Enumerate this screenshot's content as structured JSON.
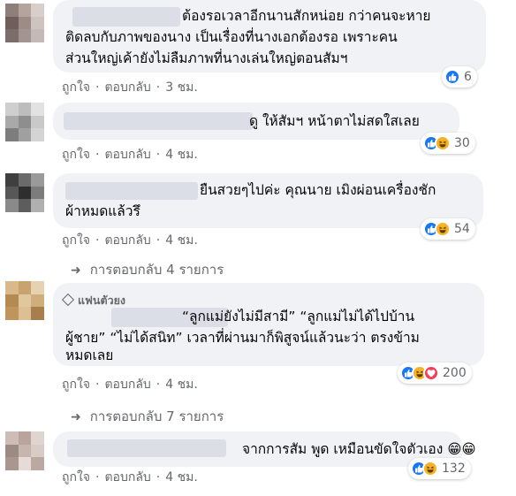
{
  "comments": [
    {
      "text_lines": [
        "ต้องรอเวลาอีกนานสักหน่อย กว่าคนจะหาย",
        "ติดลบกับภาพของนาง เป็นเรื่องที่นางเอกต้องรอ เพราะคน",
        "ส่วนใหญ่เค้ายังไม่ลืมภาพที่นางเล่นใหญ่ตอนสัมฯ"
      ],
      "like": "ถูกใจ",
      "reply": "ตอบกลับ",
      "time": "3 ชม.",
      "reaction_icons": [
        "like-icon"
      ],
      "reaction_count": "6"
    },
    {
      "text_lines": [
        "ดู ให้สัมฯ หน้าตาไม่สดใสเลย"
      ],
      "like": "ถูกใจ",
      "reply": "ตอบกลับ",
      "time": "4 ชม.",
      "reaction_icons": [
        "like-icon",
        "haha-icon"
      ],
      "reaction_count": "30"
    },
    {
      "text_lines": [
        "ยืนสวยๆไปค่ะ คุณนาย เมิงผ่อนเครื่องชัก",
        "ผ้าหมดแล้วรึ"
      ],
      "like": "ถูกใจ",
      "reply": "ตอบกลับ",
      "time": "4 ชม.",
      "reaction_icons": [
        "like-icon",
        "haha-icon"
      ],
      "reaction_count": "54",
      "replies_label": "การตอบกลับ 4 รายการ"
    },
    {
      "badge": "แฟนตัวยง",
      "text_lines": [
        "“ลูกแม่ยังไม่มีสามี” “ลูกแม่ไม่ได้ไปบ้าน",
        "ผู้ชาย” “ไม่ได้สนิท” เวลาที่ผ่านมาก็พิสูจน์แล้วนะว่า ตรงข้าม",
        "หมดเลย"
      ],
      "like": "ถูกใจ",
      "reply": "ตอบกลับ",
      "time": "4 ชม.",
      "reaction_icons": [
        "like-icon",
        "haha-icon",
        "love-icon"
      ],
      "reaction_count": "200",
      "replies_label": "การตอบกลับ 7 รายการ"
    },
    {
      "text_lines": [
        "จากการสัม พูด เหมือนขัดใจตัวเอง 😁😁"
      ],
      "like": "ถูกใจ",
      "reply": "ตอบกลับ",
      "time": "4 ชม.",
      "reaction_icons": [
        "like-icon",
        "haha-icon"
      ],
      "reaction_count": "132"
    }
  ],
  "colors": {
    "bubble": "#f0f2f5",
    "meta_text": "#65676b",
    "like_blue": "#1877f2",
    "haha_yellow": "#f7b125",
    "love_red": "#f33e58"
  }
}
